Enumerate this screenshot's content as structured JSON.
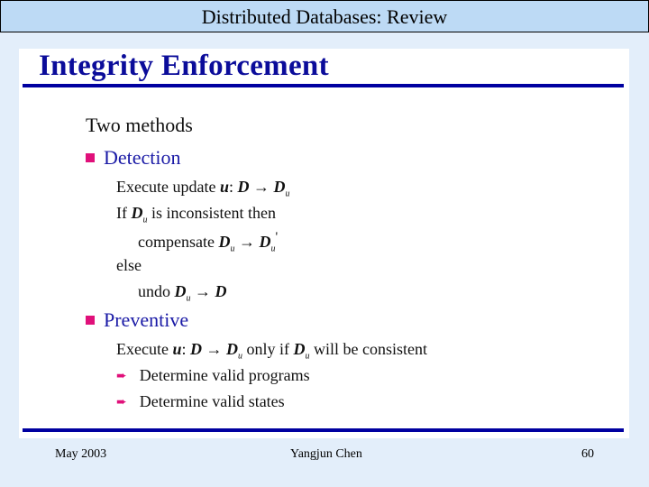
{
  "header": {
    "title": "Distributed Databases: Review"
  },
  "slide": {
    "title": "Integrity Enforcement",
    "intro": "Two methods",
    "detection": {
      "label": "Detection",
      "lines": [
        {
          "pre": "Execute update ",
          "var": "u",
          "mid": ": ",
          "expr": "D → D",
          "sub": "u",
          "post": ""
        },
        {
          "text_a": "If ",
          "var": "D",
          "sub": "u",
          "text_b": " is inconsistent then"
        },
        {
          "text_a": "compensate ",
          "expr1": "D",
          "sub1": "u",
          "arrow": " → ",
          "expr2": "D",
          "sub2": "u",
          "sup": "'"
        },
        {
          "text": "else"
        },
        {
          "text_a": "undo ",
          "expr1": "D",
          "sub1": "u",
          "arrow": " → ",
          "expr2": "D"
        }
      ]
    },
    "preventive": {
      "label": "Preventive",
      "line": {
        "pre": "Execute ",
        "var": "u",
        "mid": ": ",
        "expr": "D → D",
        "sub": "u",
        "text_b": " only if ",
        "var2": "D",
        "sub2": "u",
        "text_c": " will be consistent"
      },
      "subitems": [
        "Determine valid programs",
        "Determine valid states"
      ]
    }
  },
  "footer": {
    "date": "May 2003",
    "author": "Yangjun Chen",
    "page": "60"
  },
  "colors": {
    "accent": "#e0107a",
    "title": "#0b0c9a",
    "rule": "#0000a0",
    "header_bg": "#bddaf5",
    "background": "#e3eefa"
  }
}
